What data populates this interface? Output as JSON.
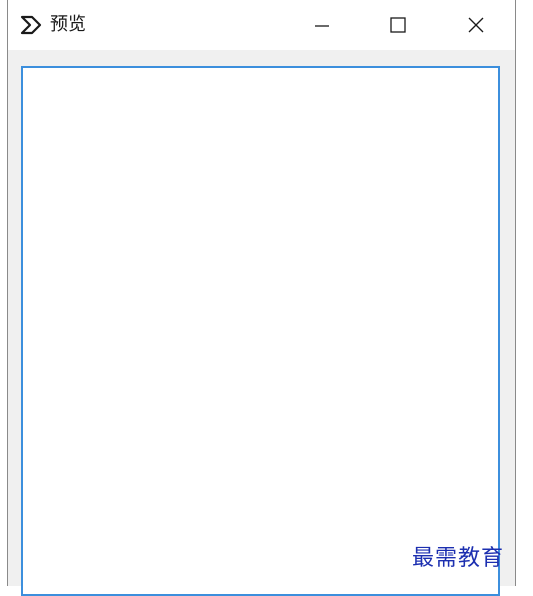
{
  "window": {
    "title": "预览",
    "app_icon": "chevron-logo-icon",
    "controls": {
      "minimize_icon": "minimize-icon",
      "maximize_icon": "maximize-icon",
      "close_icon": "close-icon"
    }
  },
  "watermark": "最需教育",
  "colors": {
    "titlebar_bg": "#ffffff",
    "window_bg": "#f0f0f0",
    "content_border": "#3c8fdd",
    "watermark": "#1c2fb0"
  }
}
